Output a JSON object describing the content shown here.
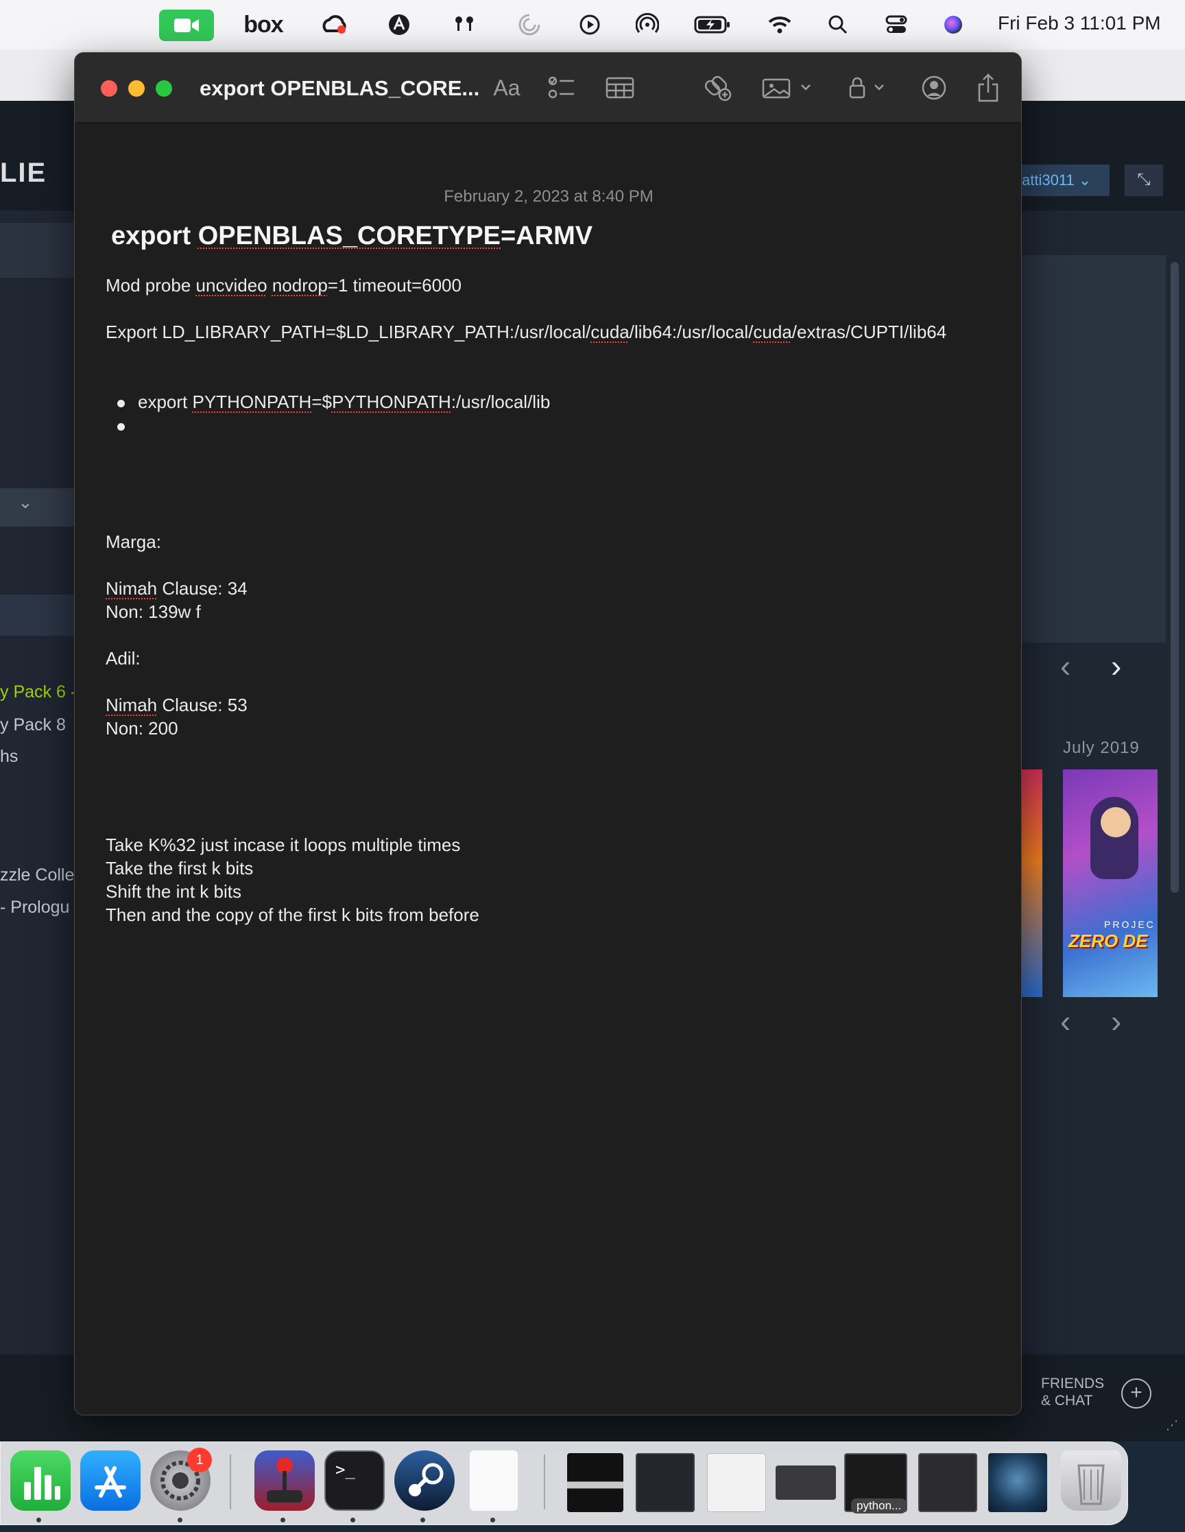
{
  "menubar": {
    "box_label": "box",
    "clock": "Fri Feb 3  11:01 PM",
    "icons": [
      "facetime-icon",
      "box-icon",
      "creative-cloud-icon",
      "avast-icon",
      "airpods-icon",
      "loading-icon",
      "play-icon",
      "airdrop-icon",
      "battery-icon",
      "wifi-icon",
      "search-icon",
      "control-center-icon",
      "siri-icon"
    ]
  },
  "steam": {
    "library_label": "LIE",
    "user_label": "atti3011 ⌄",
    "sidebar": [
      "y Pack 6 -",
      "y Pack 8",
      "hs",
      "zzle Colle",
      "- Prologu"
    ],
    "date_label": "July 2019",
    "art_title": "ZERO DE",
    "art_sub": "PROJEC",
    "friends_line1": "FRIENDS",
    "friends_line2": "& CHAT"
  },
  "notes": {
    "window_title": "export OPENBLAS_CORE...",
    "font_button": "Aa",
    "date": "February 2, 2023 at 8:40 PM",
    "heading_plain": "export ",
    "heading_sq": "OPENBLAS_CORETYPE",
    "heading_rest": "=ARMV",
    "line1_a": "Mod probe ",
    "line1_b": "uncvideo",
    "line1_c": " ",
    "line1_d": "nodrop",
    "line1_e": "=1 timeout=6000",
    "line2_a": "Export LD_LIBRARY_PATH=$LD_LIBRARY_PATH:/usr/local/",
    "line2_b": "cuda",
    "line2_c": "/lib64:/usr/local/",
    "line2_d": "cuda",
    "line2_e": "/extras/CUPTI/lib64",
    "bullet1_a": "export ",
    "bullet1_b": "PYTHONPATH",
    "bullet1_c": "=$",
    "bullet1_d": "PYTHONPATH",
    "bullet1_e": ":/usr/local/lib",
    "marga": "Marga:",
    "marga_clause_a": "Nimah",
    "marga_clause_b": " Clause: 34",
    "marga_non": "Non: 139w f",
    "adil": "Adil:",
    "adil_clause_a": "Nimah",
    "adil_clause_b": " Clause: 53",
    "adil_non": "Non: 200",
    "step1": "Take K%32 just incase it loops multiple times",
    "step2": "Take the first k bits",
    "step3": "Shift the int k bits",
    "step4": "Then and the copy of the first k bits from before"
  },
  "dock": {
    "badge": "1",
    "terminal_glyph": ">_",
    "python_label": "python..."
  }
}
